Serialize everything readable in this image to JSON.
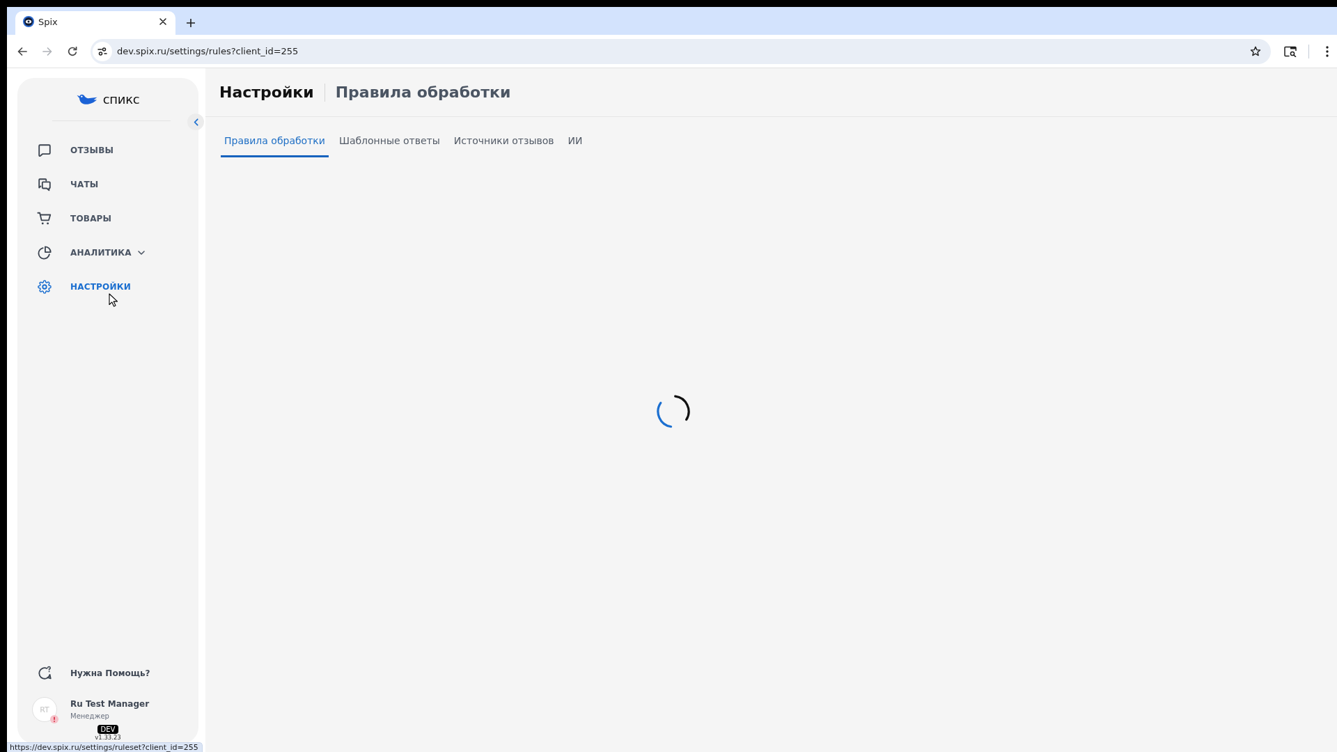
{
  "browser": {
    "tabs": [
      {
        "title": "Spix",
        "selected": true
      }
    ],
    "back": {
      "disabled": false
    },
    "forward": {
      "disabled": true
    },
    "address_bar": {
      "url": "dev.spix.ru/settings/rules?client_id=255"
    },
    "status_url": "https://dev.spix.ru/settings/ruleset?client_id=255"
  },
  "sidebar": {
    "logo": "спикс",
    "nav_items": [
      {
        "label": "ОТЗЫВЫ",
        "selected": false,
        "submenu": false
      },
      {
        "label": "ЧАТЫ",
        "selected": false,
        "submenu": false
      },
      {
        "label": "ТОВАРЫ",
        "selected": false,
        "submenu": false
      },
      {
        "label": "АНАЛИТИКА",
        "selected": false,
        "submenu": true
      },
      {
        "label": "НАСТРОЙКИ",
        "selected": true,
        "submenu": false
      }
    ],
    "help": "Нужна Помощь?",
    "user": {
      "initials": "RT",
      "name": "Ru Test Manager",
      "role": "Менеджер",
      "alert": true
    },
    "environment": "DEV",
    "version": "v1.33.23"
  },
  "header": {
    "title": "Настройки",
    "subtitle": "Правила обработки"
  },
  "tabs": [
    {
      "label": "Правила обработки",
      "selected": true
    },
    {
      "label": "Шаблонные ответы",
      "selected": false
    },
    {
      "label": "Источники отзывов",
      "selected": false
    },
    {
      "label": "ИИ",
      "selected": false
    }
  ],
  "content": {
    "loading": true
  }
}
